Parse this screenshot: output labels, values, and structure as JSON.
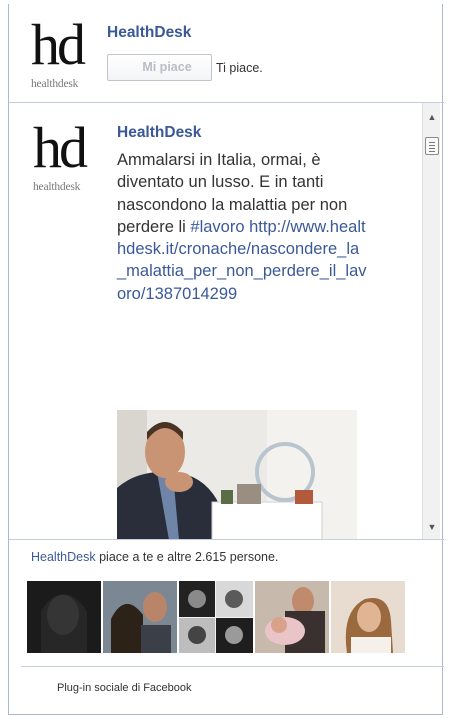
{
  "header": {
    "logo_mark": "hd",
    "logo_word": "healthdesk",
    "page_name": "HealthDesk",
    "like_button_label": "Mi piace",
    "like_status": "Ti piace."
  },
  "post": {
    "author": "HealthDesk",
    "text": "Ammalarsi in Italia, ormai, è diventato un lusso. E in tanti nascondono la malattia per non perdere li",
    "hashtag": "#lavoro",
    "url": "http://www.healthdesk.it/cronache/nascondere_la_malattia_per_non_perdere_il_lavoro/1387014299"
  },
  "social": {
    "page_link": "HealthDesk",
    "likes_text": "piace a te e altre 2.615 persone."
  },
  "footer": {
    "label": "Plug-in sociale di Facebook"
  },
  "colors": {
    "link_blue": "#3b5998",
    "border": "#aab8d4"
  },
  "icons": {
    "like": "thumbs-up-icon",
    "scroll_up": "arrow-up-icon",
    "scroll_down": "arrow-down-icon"
  }
}
